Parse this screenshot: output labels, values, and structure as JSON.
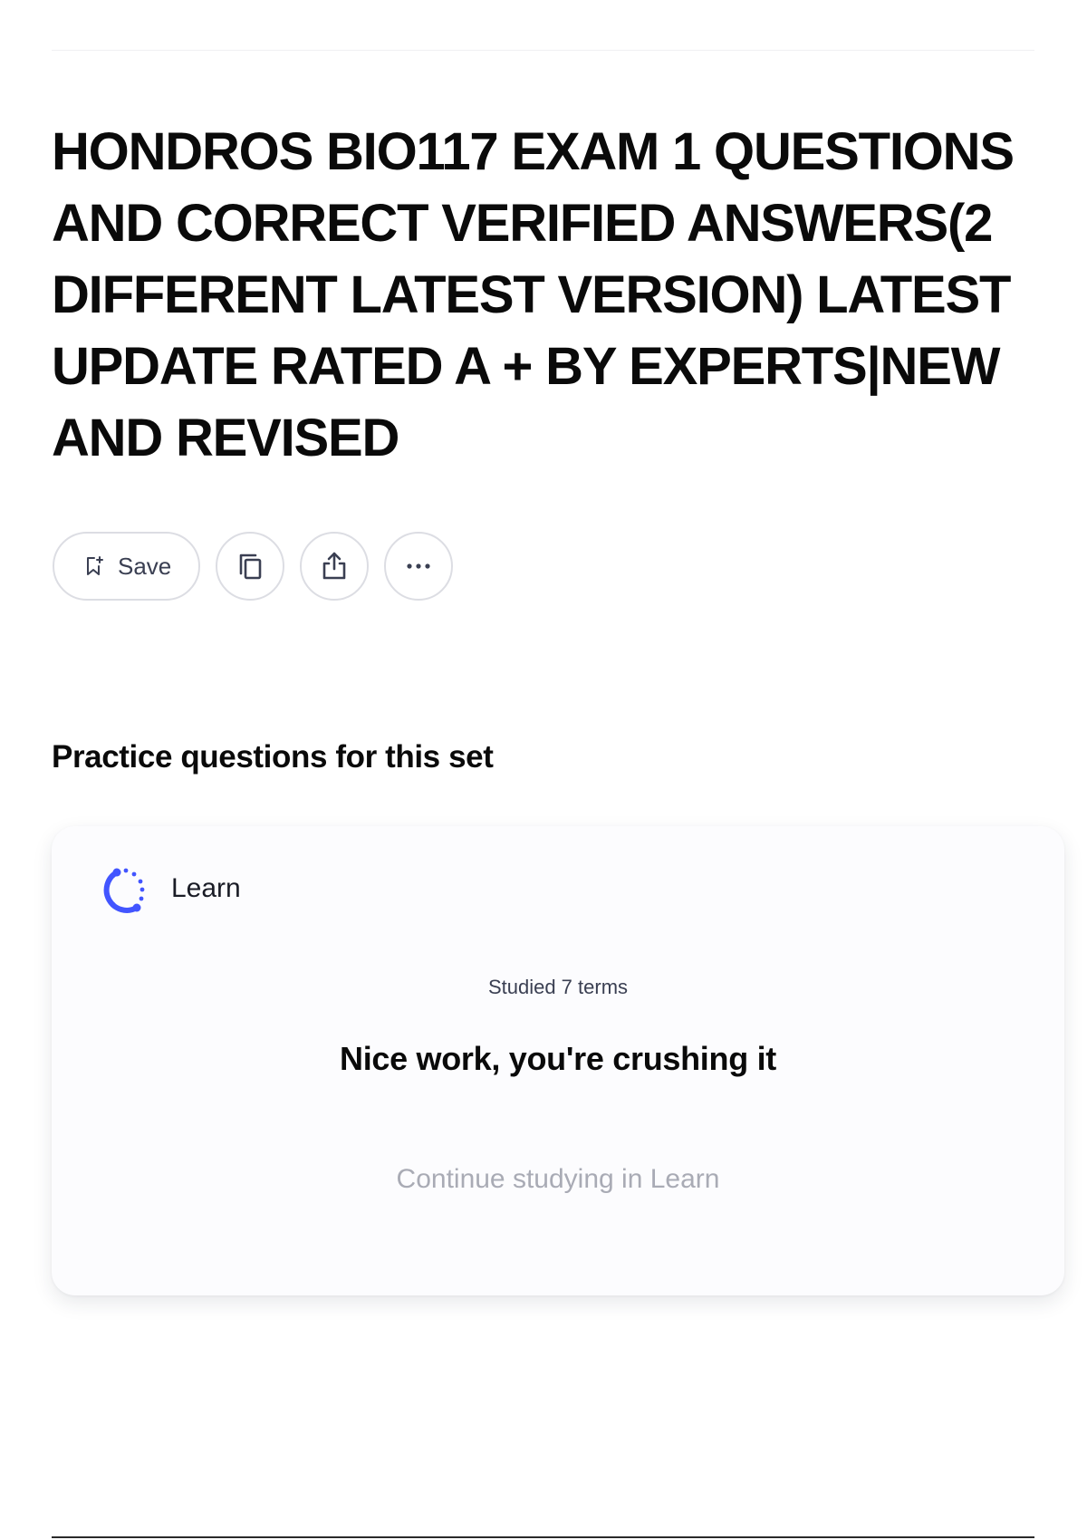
{
  "title": "HONDROS BIO117 EXAM 1 QUESTIONS AND CORRECT VERIFIED ANSWERS(2 DIFFERENT LATEST VERSION) LATEST UPDATE RATED A + BY EXPERTS|NEW AND REVISED",
  "actions": {
    "save_label": "Save",
    "icons": [
      "save-add-icon",
      "copy-icon",
      "share-icon",
      "more-icon"
    ]
  },
  "practice": {
    "heading": "Practice questions for this set",
    "card": {
      "title": "Learn",
      "icon": "learn-progress-icon",
      "studied": "Studied 7 terms",
      "message": "Nice work, you're crushing it",
      "continue_label": "Continue studying in Learn"
    }
  },
  "colors": {
    "accent": "#4255ff",
    "text": "#0a0a0a",
    "muted": "#a9abb5",
    "border": "#dcdde3"
  }
}
